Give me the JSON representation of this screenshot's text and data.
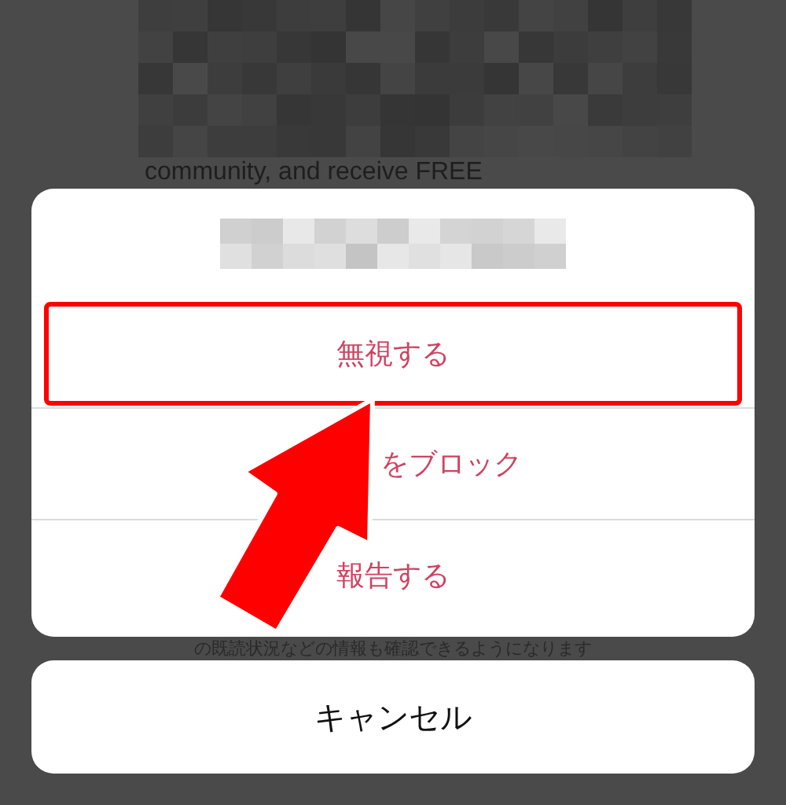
{
  "background": {
    "kind": "picture",
    "caption": "community, and receive FREE",
    "footnote": "の既読状況などの情報も確認できるようになります"
  },
  "action_sheet": {
    "title": {
      "kind": "blurred"
    },
    "actions": [
      {
        "label": "無視する",
        "highlighted": true,
        "covered": false
      },
      {
        "label": "をブロック",
        "highlighted": false,
        "covered": true
      },
      {
        "label": "報告する",
        "highlighted": false,
        "covered": false
      }
    ],
    "cancel": "キャンセル"
  },
  "annotation": {
    "kind": "arrow"
  }
}
